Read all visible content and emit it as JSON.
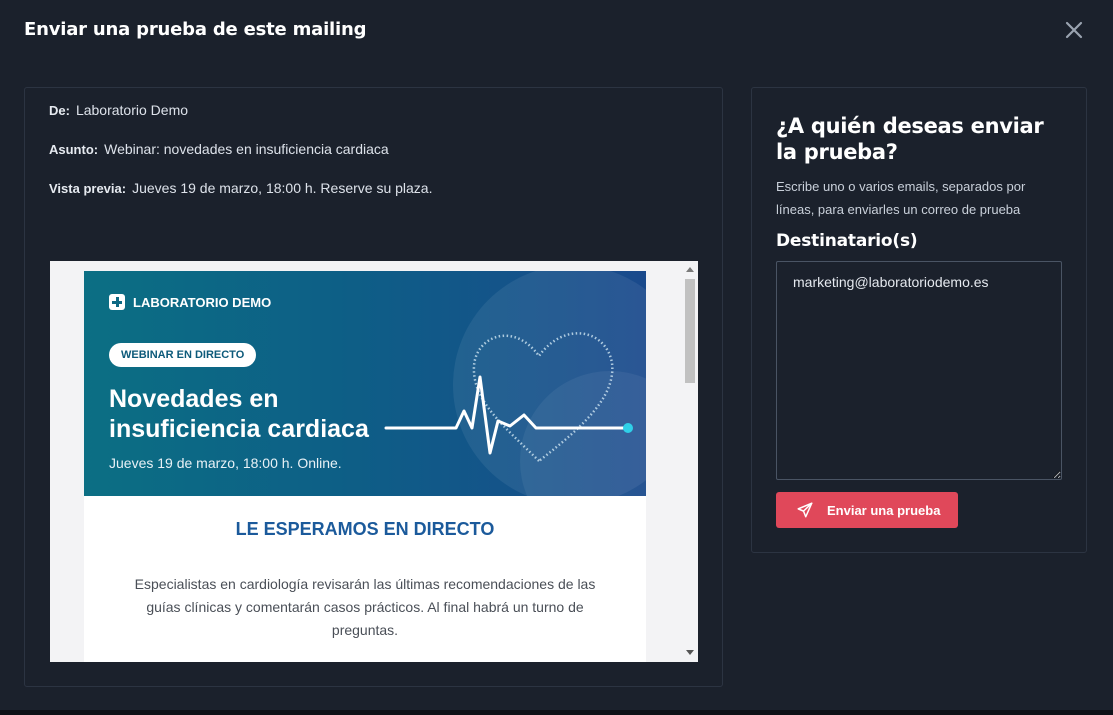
{
  "modal": {
    "title": "Enviar una prueba de este mailing",
    "close_icon": "close-icon"
  },
  "meta": {
    "from_label": "De:",
    "from_value": "Laboratorio Demo",
    "subject_label": "Asunto:",
    "subject_value": "Webinar: novedades en insuficiencia cardiaca",
    "preview_label": "Vista previa:",
    "preview_value": "Jueves 19 de marzo, 18:00 h. Reserve su plaza."
  },
  "email": {
    "brand_icon": "medical-cross-icon",
    "brand_name": "LABORATORIO DEMO",
    "badge": "WEBINAR EN DIRECTO",
    "hero_title": "Novedades en insuficiencia cardiaca",
    "hero_date": "Jueves 19 de marzo, 18:00 h. Online.",
    "hero_graphic": "heart-pulse-icon",
    "section_title": "LE ESPERAMOS EN DIRECTO",
    "section_body": "Especialistas en cardiología revisarán las últimas recomendaciones de las guías clínicas y comentarán casos prácticos. Al final habrá un turno de preguntas."
  },
  "send_panel": {
    "heading": "¿A quién deseas enviar la prueba?",
    "description": "Escribe uno o varios emails, separados por líneas, para enviarles un correo de prueba",
    "recipients_label": "Destinatario(s)",
    "recipients_value": "marketing@laboratoriodemo.es",
    "send_button_label": "Enviar una prueba",
    "send_icon": "paper-plane-icon"
  },
  "colors": {
    "background": "#1b212c",
    "accent": "#e0485a",
    "hero_start": "#0c6f84",
    "hero_end": "#1a4a8c",
    "section_title": "#1b5a9b"
  }
}
